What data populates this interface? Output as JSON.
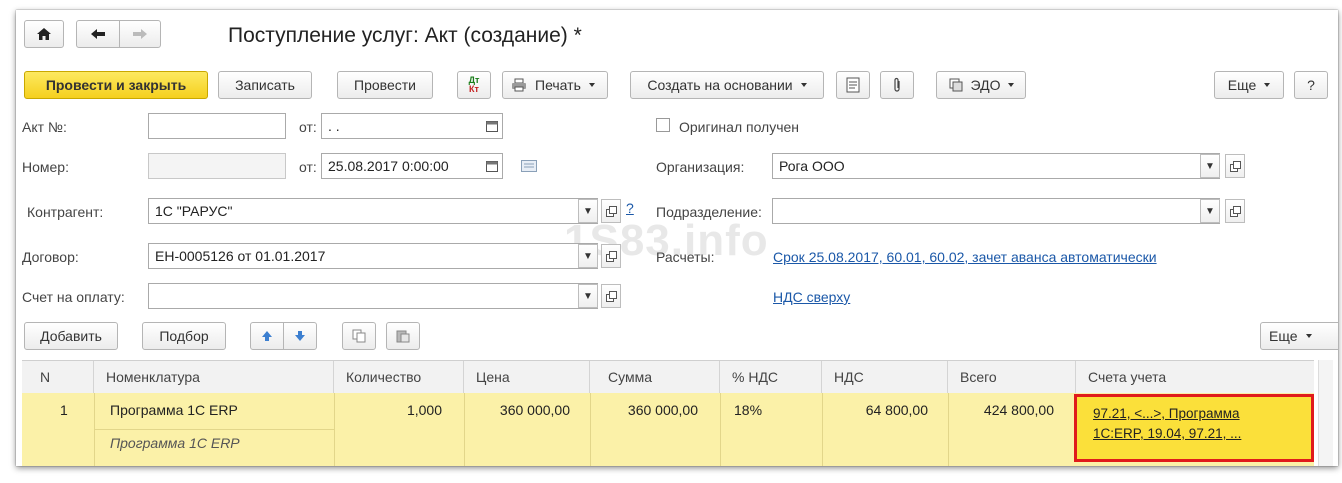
{
  "window": {
    "title": "Поступление услуг: Акт (создание) *"
  },
  "toolbar": {
    "post_close": "Провести и закрыть",
    "save": "Записать",
    "post": "Провести",
    "print": "Печать",
    "create_based": "Создать на основании",
    "edo": "ЭДО",
    "more": "Еще",
    "help": "?",
    "dtkt_top": "Дт",
    "dtkt_bottom": "Кт"
  },
  "form": {
    "act_no_label": "Акт №:",
    "act_no_value": "",
    "act_date_label": "от:",
    "act_date_value": " .  .",
    "original_label": "Оригинал получен",
    "number_label": "Номер:",
    "number_value": "",
    "date_label": "от:",
    "date_value": "25.08.2017  0:00:00",
    "org_label": "Организация:",
    "org_value": "Рога ООО",
    "counterparty_label": "Контрагент:",
    "counterparty_value": "1С \"РАРУС\"",
    "question": "?",
    "dept_label": "Подразделение:",
    "dept_value": "",
    "contract_label": "Договор:",
    "contract_value": "ЕН-0005126 от 01.01.2017",
    "settlements_label": "Расчеты:",
    "settlements_link": "Срок 25.08.2017, 60.01, 60.02, зачет аванса автоматически",
    "invoice_label": "Счет на оплату:",
    "invoice_value": "",
    "vat_link": "НДС сверху"
  },
  "watermark": "1S83.info",
  "table_toolbar": {
    "add": "Добавить",
    "select": "Подбор",
    "more": "Еще"
  },
  "table": {
    "columns": [
      "N",
      "Номенклатура",
      "Количество",
      "Цена",
      "Сумма",
      "% НДС",
      "НДС",
      "Всего",
      "Счета учета"
    ],
    "rows": [
      {
        "n": "1",
        "item": "Программа 1С ERP",
        "item_sub": "Программа 1С ERP",
        "qty": "1,000",
        "price": "360 000,00",
        "sum": "360 000,00",
        "vat_rate": "18%",
        "vat": "64 800,00",
        "total": "424 800,00",
        "accounts_line1": "97.21, <...>, Программа",
        "accounts_line2": "1С:ERP, 19.04, 97.21, ..."
      }
    ]
  },
  "colors": {
    "primary_button": "#f5d01e",
    "selected_row": "#fbf1a8",
    "highlight_cell": "#fbe03a",
    "highlight_border": "#e01b1b",
    "link": "#1b58a8"
  }
}
